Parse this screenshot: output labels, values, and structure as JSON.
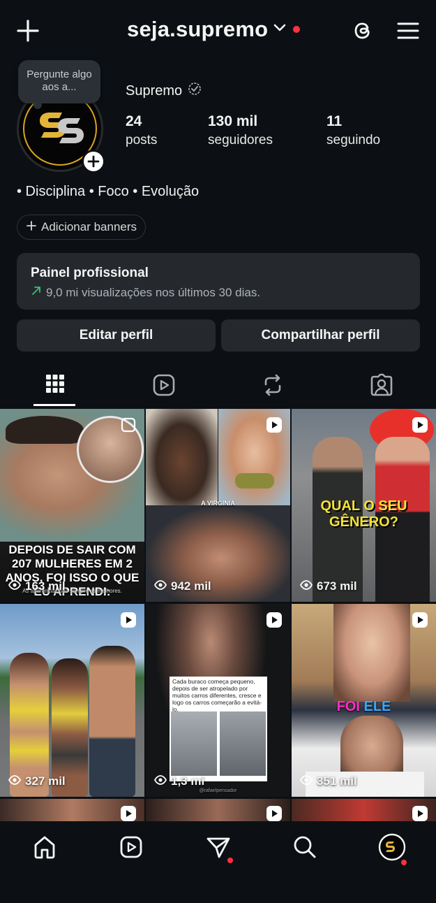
{
  "header": {
    "username": "seja.supremo"
  },
  "note": {
    "text": "Pergunte algo aos a..."
  },
  "profile": {
    "display_name": "Supremo",
    "stats": [
      {
        "num": "24",
        "label": "posts"
      },
      {
        "num": "130 mil",
        "label": "seguidores"
      },
      {
        "num": "11",
        "label": "seguindo"
      }
    ],
    "bio": "• Disciplina • Foco • Evolução",
    "add_banners": "Adicionar banners"
  },
  "panel": {
    "title": "Painel profissional",
    "subtitle": "9,0 mi visualizações nos últimos 30 dias."
  },
  "buttons": {
    "edit": "Editar perfil",
    "share": "Compartilhar perfil"
  },
  "posts": [
    {
      "views": "163 mil",
      "caption": "DEPOIS DE SAIR COM 207 MULHERES EM 2 ANOS, FOI ISSO O QUE EU APRENDI:",
      "sub": "As aparências são sempre as melhores."
    },
    {
      "views": "942 mil",
      "caption": "A VIRGINIA"
    },
    {
      "views": "673 mil",
      "caption": "QUAL O SEU GÊNERO?"
    },
    {
      "views": "327 mil"
    },
    {
      "views": "1,3 mi",
      "caption": "Cada buraco começa pequeno, depois de ser atropelado por muitos carros diferentes, cresce e logo os carros começarão a evitá-lo.",
      "credit": "@rafaelpensador"
    },
    {
      "views": "351 mil",
      "caption_a": "FOI",
      "caption_b": "ELE"
    }
  ],
  "colors": {
    "background": "#0c1014",
    "surface": "#25292e",
    "notification": "#ff3040",
    "trend_arrow": "#3fbd7c",
    "logo_gold": "#d9a520"
  }
}
